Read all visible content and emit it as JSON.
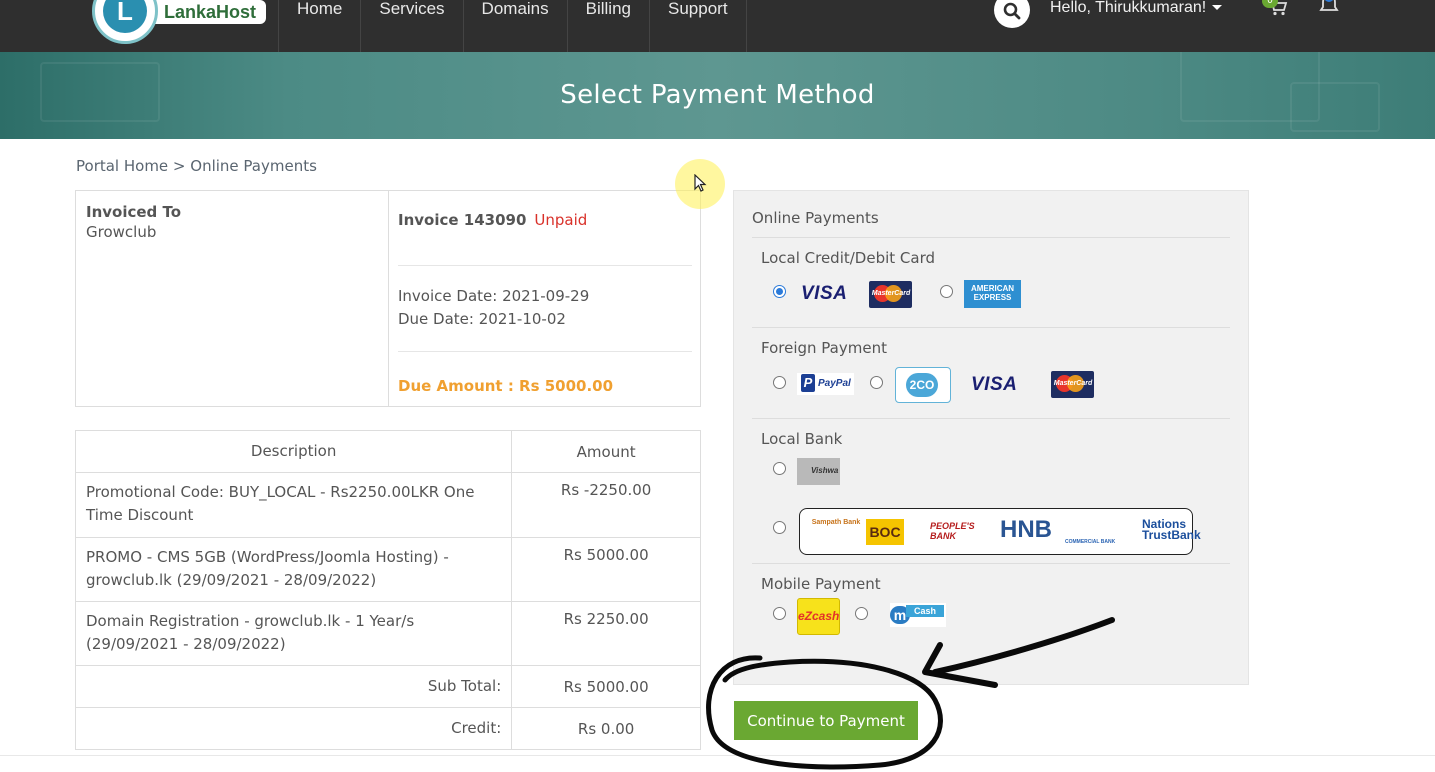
{
  "navbar": {
    "logo_letter": "L",
    "logo_text": "LankaHost",
    "links": [
      "Home",
      "Services",
      "Domains",
      "Billing",
      "Support"
    ],
    "user_greeting": "Hello, Thirukkumaran!",
    "cart_count": "0",
    "icons": [
      "search-icon",
      "cart-icon",
      "bell-icon"
    ]
  },
  "hero": {
    "title": "Select Payment Method"
  },
  "breadcrumb": "Portal Home > Online Payments",
  "invoice": {
    "invoiced_to_label": "Invoiced To",
    "invoiced_to": "Growclub",
    "number": "Invoice 143090",
    "status": "Unpaid",
    "invoice_date": "Invoice Date: 2021-09-29",
    "due_date": "Due Date: 2021-10-02",
    "due_amount": "Due Amount : Rs 5000.00"
  },
  "items_table": {
    "headers": [
      "Description",
      "Amount"
    ],
    "rows": [
      {
        "description": "Promotional Code: BUY_LOCAL - Rs2250.00LKR One Time Discount",
        "amount": "Rs -2250.00"
      },
      {
        "description": "PROMO - CMS 5GB (WordPress/Joomla Hosting) - growclub.lk (29/09/2021 - 28/09/2022)",
        "amount": "Rs 5000.00"
      },
      {
        "description": "Domain Registration - growclub.lk - 1 Year/s (29/09/2021 - 28/09/2022)",
        "amount": "Rs 2250.00"
      }
    ],
    "subtotal_label": "Sub Total:",
    "subtotal": "Rs 5000.00",
    "credit_label": "Credit:",
    "credit": "Rs 0.00"
  },
  "payment": {
    "heading": "Online Payments",
    "sections": {
      "local_card": "Local Credit/Debit Card",
      "foreign": "Foreign Payment",
      "local_bank": "Local Bank",
      "mobile": "Mobile Payment"
    },
    "selected": "local-visa-mastercard",
    "logos": {
      "visa": "VISA",
      "mastercard": "MasterCard",
      "amex_line1": "AMERICAN",
      "amex_line2": "EXPRESS",
      "paypal": "PayPal",
      "paypal_p": "P",
      "twoco": "2CO",
      "vishwa": "Vishwa",
      "sampath": "Sampath Bank",
      "boc": "BOC",
      "peoples": "PEOPLE'S BANK",
      "hnb": "HNB",
      "commercial": "COMMERCIAL BANK",
      "nations": "Nations TrustBank",
      "ezcash": "eZcash",
      "mcash_m": "m",
      "mcash": "Cash"
    },
    "continue_label": "Continue to Payment"
  },
  "colors": {
    "navbar": "#2f2f2f",
    "accent_green": "#6aa832",
    "unpaid_red": "#d9312a",
    "due_orange": "#f0a030",
    "hero_teal": "#4c8b85"
  }
}
